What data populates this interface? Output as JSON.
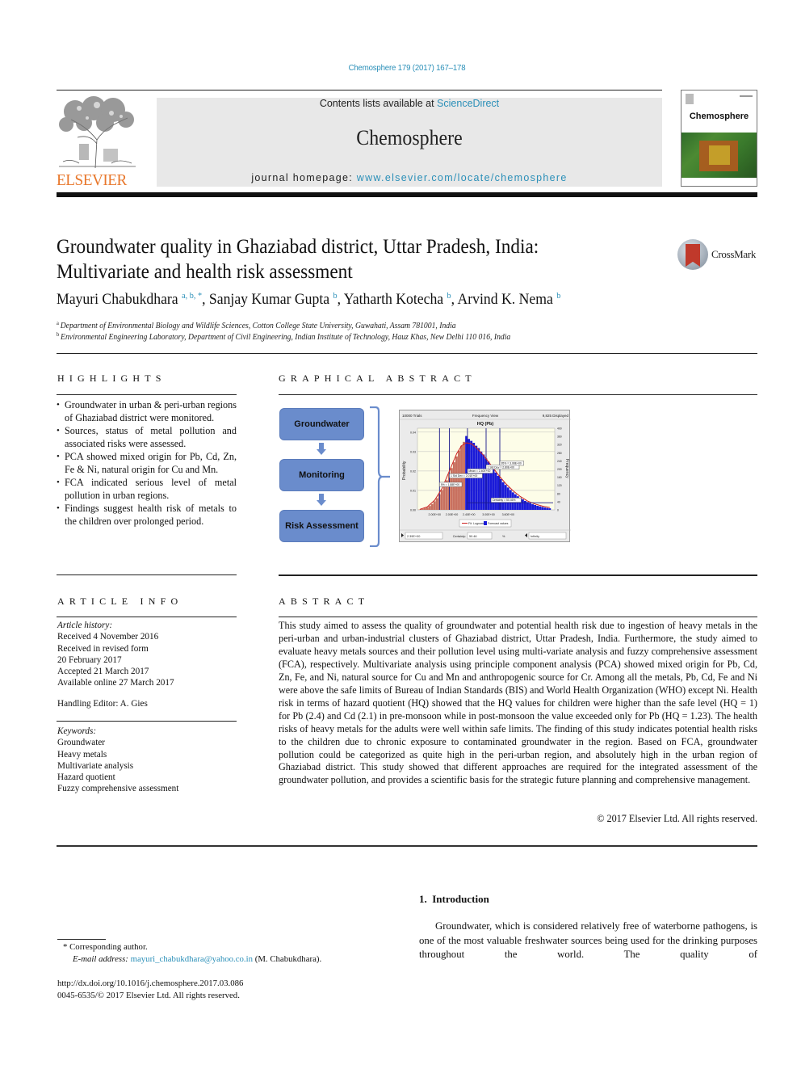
{
  "header": {
    "citation": "Chemosphere 179 (2017) 167–178",
    "contents_prefix": "Contents lists available at ",
    "contents_link": "ScienceDirect",
    "journal_name": "Chemosphere",
    "homepage_prefix": "journal homepage: ",
    "homepage_link": "www.elsevier.com/locate/chemosphere",
    "publisher_logo_text": "ELSEVIER",
    "cover_title": "Chemosphere"
  },
  "article": {
    "title_line1": "Groundwater quality in Ghaziabad district, Uttar Pradesh, India:",
    "title_line2": "Multivariate and health risk assessment",
    "crossmark_label": "CrossMark",
    "authors": [
      {
        "name": "Mayuri Chabukdhara",
        "sup": "a, b, *"
      },
      {
        "name": "Sanjay Kumar Gupta",
        "sup": "b"
      },
      {
        "name": "Yatharth Kotecha",
        "sup": "b"
      },
      {
        "name": "Arvind K. Nema",
        "sup": "b"
      }
    ],
    "affiliations": [
      {
        "mark": "a",
        "text": "Department of Environmental Biology and Wildlife Sciences, Cotton College State University, Guwahati, Assam 781001, India"
      },
      {
        "mark": "b",
        "text": "Environmental Engineering Laboratory, Department of Civil Engineering, Indian Institute of Technology, Hauz Khas, New Delhi 110 016, India"
      }
    ]
  },
  "highlights": {
    "heading": "HIGHLIGHTS",
    "items": [
      "Groundwater in urban & peri-urban regions of Ghaziabad district were monitored.",
      "Sources, status of metal pollution and associated risks were assessed.",
      "PCA showed mixed origin for Pb, Cd, Zn, Fe & Ni, natural origin for Cu and Mn.",
      "FCA indicated serious level of metal pollution in urban regions.",
      "Findings suggest health risk of metals to the children over prolonged period."
    ]
  },
  "graphical_abstract": {
    "heading": "GRAPHICAL ABSTRACT",
    "flow": [
      "Groundwater",
      "Monitoring",
      "Risk Assessment"
    ],
    "colors": {
      "box": "#6a8ccc",
      "below_bars": "#c8705f",
      "above_bars": "#1a1ad8",
      "fit_line": "#cc2222",
      "marker_lines": "#1a1a8a",
      "plot_bg": "#fdfde8"
    }
  },
  "chart_data": {
    "type": "bar",
    "title": "HQ (Pb)",
    "header_left": "10000 Trials",
    "header_center": "Frequency View",
    "header_right": "9,825 Displayed",
    "ylabel": "Probability",
    "ylabel_right": "Frequency",
    "yticks_left": [
      "0.04",
      "0.03",
      "0.02",
      "0.01",
      "0.00"
    ],
    "yticks_right": [
      "400",
      "360",
      "320",
      "280",
      "240",
      "200",
      "160",
      "120",
      "80",
      "40",
      "0"
    ],
    "xticks": [
      "2.00E+00",
      "2.00E+00",
      "2.40E+00",
      "3.00E+00",
      "3.60E+00"
    ],
    "ylim": [
      0,
      0.042
    ],
    "xlim": [
      1.4,
      4.2
    ],
    "split_x": 2.4,
    "histogram_x": [
      1.45,
      1.5,
      1.55,
      1.6,
      1.65,
      1.7,
      1.75,
      1.8,
      1.85,
      1.9,
      1.95,
      2.0,
      2.05,
      2.1,
      2.15,
      2.2,
      2.25,
      2.3,
      2.35,
      2.4,
      2.45,
      2.5,
      2.55,
      2.6,
      2.65,
      2.7,
      2.75,
      2.8,
      2.85,
      2.9,
      2.95,
      3.0,
      3.05,
      3.1,
      3.15,
      3.2,
      3.25,
      3.3,
      3.35,
      3.4,
      3.45,
      3.5,
      3.55,
      3.6,
      3.65,
      3.7,
      3.75,
      3.8,
      3.85,
      3.9,
      3.95,
      4.0,
      4.05,
      4.1
    ],
    "histogram_p": [
      0.0002,
      0.0004,
      0.0008,
      0.0012,
      0.002,
      0.003,
      0.0044,
      0.006,
      0.008,
      0.0102,
      0.0128,
      0.0152,
      0.0185,
      0.0215,
      0.0245,
      0.0275,
      0.0305,
      0.033,
      0.035,
      0.038,
      0.0365,
      0.0355,
      0.0345,
      0.033,
      0.0318,
      0.03,
      0.0285,
      0.0265,
      0.0248,
      0.0228,
      0.021,
      0.0192,
      0.0175,
      0.0158,
      0.0142,
      0.0128,
      0.0115,
      0.0102,
      0.009,
      0.008,
      0.007,
      0.0062,
      0.0054,
      0.0046,
      0.004,
      0.0034,
      0.0029,
      0.0025,
      0.0021,
      0.0018,
      0.0015,
      0.0012,
      0.001,
      0.0008
    ],
    "fit_x": [
      1.45,
      1.6,
      1.75,
      1.9,
      2.05,
      2.2,
      2.3,
      2.4,
      2.5,
      2.6,
      2.75,
      2.9,
      3.05,
      3.2,
      3.35,
      3.5,
      3.65,
      3.8,
      3.95,
      4.1
    ],
    "fit_p": [
      0.0003,
      0.0015,
      0.005,
      0.011,
      0.02,
      0.029,
      0.033,
      0.0345,
      0.034,
      0.032,
      0.028,
      0.023,
      0.018,
      0.0135,
      0.0098,
      0.0068,
      0.0045,
      0.003,
      0.0019,
      0.0012
    ],
    "marker_lines_x": [
      1.85,
      2.05,
      2.42,
      2.8,
      3.08
    ],
    "annotations": [
      "5% = 1.88E+00",
      "1 Std Dev = 2.01E+00",
      "Mean = 2.40E+00",
      "1 Std Dev = 2.80E+00",
      "95% = 3.08E+00",
      "Certainty = 50.46%"
    ],
    "legend": [
      {
        "name": "Fit: Lognormal",
        "type": "line"
      },
      {
        "name": "Forecast values",
        "type": "bar"
      }
    ],
    "legend_position": "bottom",
    "footer": {
      "left_value": "2.39E+00",
      "certainty_label": "Certainty:",
      "certainty_value": "50.46",
      "percent": "%",
      "right_value": "Infinity"
    }
  },
  "article_info": {
    "heading": "ARTICLE INFO",
    "history_label": "Article history:",
    "history": [
      "Received 4 November 2016",
      "Received in revised form",
      "20 February 2017",
      "Accepted 21 March 2017",
      "Available online 27 March 2017"
    ],
    "editor": "Handling Editor: A. Gies",
    "keywords_label": "Keywords:",
    "keywords": [
      "Groundwater",
      "Heavy metals",
      "Multivariate analysis",
      "Hazard quotient",
      "Fuzzy comprehensive assessment"
    ]
  },
  "abstract": {
    "heading": "ABSTRACT",
    "text": "This study aimed to assess the quality of groundwater and potential health risk due to ingestion of heavy metals in the peri-urban and urban-industrial clusters of Ghaziabad district, Uttar Pradesh, India. Furthermore, the study aimed to evaluate heavy metals sources and their pollution level using multi-variate analysis and fuzzy comprehensive assessment (FCA), respectively. Multivariate analysis using principle component analysis (PCA) showed mixed origin for Pb, Cd, Zn, Fe, and Ni, natural source for Cu and Mn and anthropogenic source for Cr. Among all the metals, Pb, Cd, Fe and Ni were above the safe limits of Bureau of Indian Standards (BIS) and World Health Organization (WHO) except Ni. Health risk in terms of hazard quotient (HQ) showed that the HQ values for children were higher than the safe level (HQ = 1) for Pb (2.4) and Cd (2.1) in pre-monsoon while in post-monsoon the value exceeded only for Pb (HQ = 1.23). The health risks of heavy metals for the adults were well within safe limits. The finding of this study indicates potential health risks to the children due to chronic exposure to contaminated groundwater in the region. Based on FCA, groundwater pollution could be categorized as quite high in the peri-urban region, and absolutely high in the urban region of Ghaziabad district. This study showed that different approaches are required for the integrated assessment of the groundwater pollution, and provides a scientific basis for the strategic future planning and comprehensive management.",
    "copyright": "© 2017 Elsevier Ltd. All rights reserved."
  },
  "footnotes": {
    "corresponding": "* Corresponding author.",
    "email_label": "E-mail address: ",
    "email": "mayuri_chabukdhara@yahoo.co.in",
    "email_suffix": " (M. Chabukdhara).",
    "doi": "http://dx.doi.org/10.1016/j.chemosphere.2017.03.086",
    "issn": "0045-6535/© 2017 Elsevier Ltd. All rights reserved."
  },
  "introduction": {
    "heading": "1.  Introduction",
    "text": "Groundwater, which is considered relatively free of waterborne pathogens, is one of the most valuable freshwater sources being used for the drinking purposes throughout the world. The quality of"
  }
}
